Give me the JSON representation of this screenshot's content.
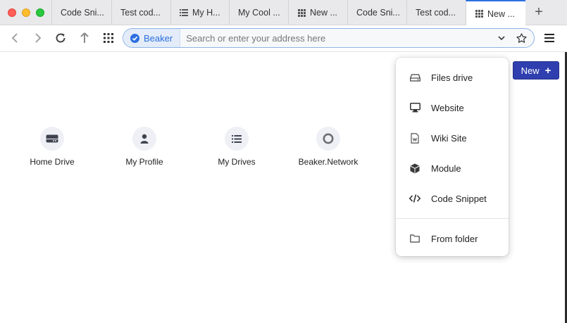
{
  "window": {
    "active_tab_index": 7
  },
  "tabs": [
    {
      "label": "Code Sni...",
      "icon": "none"
    },
    {
      "label": "Test cod...",
      "icon": "none"
    },
    {
      "label": "My H...",
      "icon": "list-icon"
    },
    {
      "label": "My Cool ...",
      "icon": "none"
    },
    {
      "label": "New ...",
      "icon": "grid-icon"
    },
    {
      "label": "Code Sni...",
      "icon": "none"
    },
    {
      "label": "Test cod...",
      "icon": "none"
    },
    {
      "label": "New ...",
      "icon": "grid-icon"
    }
  ],
  "new_tab_label": "+",
  "urlbar": {
    "site_badge": "Beaker",
    "placeholder": "Search or enter your address here"
  },
  "speed_dial": [
    {
      "label": "Home Drive",
      "icon": "hard-drive-icon"
    },
    {
      "label": "My Profile",
      "icon": "user-icon"
    },
    {
      "label": "My Drives",
      "icon": "list-icon"
    },
    {
      "label": "Beaker.Network",
      "icon": "ring-icon"
    }
  ],
  "new_button": {
    "label": "New",
    "plus": "+"
  },
  "new_menu": {
    "items": [
      {
        "label": "Files drive",
        "icon": "hard-drive-icon"
      },
      {
        "label": "Website",
        "icon": "monitor-icon"
      },
      {
        "label": "Wiki Site",
        "icon": "wiki-file-icon"
      },
      {
        "label": "Module",
        "icon": "cube-icon"
      },
      {
        "label": "Code Snippet",
        "icon": "code-icon"
      }
    ],
    "secondary": [
      {
        "label": "From folder",
        "icon": "folder-icon"
      }
    ]
  },
  "colors": {
    "accent": "#2c6fe0",
    "new_button_bg": "#2f3faf",
    "tabstrip_bg": "#e9e9eb"
  }
}
